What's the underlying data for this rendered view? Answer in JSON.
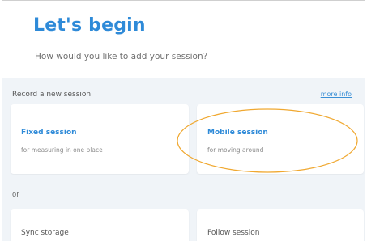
{
  "header": {
    "title": "Let's begin",
    "subtitle": "How would you like to add your session?"
  },
  "record_section": {
    "label": "Record a new session",
    "more_info": "more info",
    "cards": [
      {
        "title": "Fixed session",
        "description": "for measuring in one place"
      },
      {
        "title": "Mobile session",
        "description": "for moving around"
      }
    ]
  },
  "or_label": "or",
  "other_section": {
    "cards": [
      {
        "title": "Sync storage"
      },
      {
        "title": "Follow session"
      }
    ]
  },
  "colors": {
    "accent": "#2e8ad8",
    "panel_bg": "#f0f4f8",
    "annotation": "#f0a830"
  }
}
